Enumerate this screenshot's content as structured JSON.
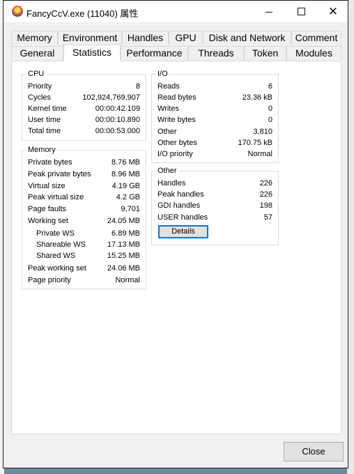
{
  "window": {
    "title": "FancyCcV.exe (11040) 属性"
  },
  "tabs_row1": [
    "Memory",
    "Environment",
    "Handles",
    "GPU",
    "Disk and Network",
    "Comment"
  ],
  "tabs_row2": [
    "General",
    "Statistics",
    "Performance",
    "Threads",
    "Token",
    "Modules"
  ],
  "active_tab": "Statistics",
  "cpu": {
    "title": "CPU",
    "rows": [
      {
        "label": "Priority",
        "value": "8"
      },
      {
        "label": "Cycles",
        "value": "102,924,769,907"
      },
      {
        "label": "Kernel time",
        "value": "00:00:42.109"
      },
      {
        "label": "User time",
        "value": "00:00:10.890"
      },
      {
        "label": "Total time",
        "value": "00:00:53.000"
      }
    ]
  },
  "memory": {
    "title": "Memory",
    "rows": [
      {
        "label": "Private bytes",
        "value": "8.76 MB"
      },
      {
        "label": "Peak private bytes",
        "value": "8.96 MB"
      },
      {
        "label": "Virtual size",
        "value": "4.19 GB"
      },
      {
        "label": "Peak virtual size",
        "value": "4.2 GB"
      },
      {
        "label": "Page faults",
        "value": "9,701"
      },
      {
        "label": "Working set",
        "value": "24.05 MB"
      },
      {
        "label": "Private WS",
        "value": "6.89 MB"
      },
      {
        "label": "Shareable WS",
        "value": "17.13 MB"
      },
      {
        "label": "Shared WS",
        "value": "15.25 MB"
      },
      {
        "label": "Peak working set",
        "value": "24.06 MB"
      },
      {
        "label": "Page priority",
        "value": "Normal"
      }
    ]
  },
  "io": {
    "title": "I/O",
    "rows": [
      {
        "label": "Reads",
        "value": "6"
      },
      {
        "label": "Read bytes",
        "value": "23.36 kB"
      },
      {
        "label": "Writes",
        "value": "0"
      },
      {
        "label": "Write bytes",
        "value": "0"
      },
      {
        "label": "Other",
        "value": "3,810"
      },
      {
        "label": "Other bytes",
        "value": "170.75 kB"
      },
      {
        "label": "I/O priority",
        "value": "Normal"
      }
    ]
  },
  "other": {
    "title": "Other",
    "rows": [
      {
        "label": "Handles",
        "value": "226"
      },
      {
        "label": "Peak handles",
        "value": "226"
      },
      {
        "label": "GDI handles",
        "value": "198"
      },
      {
        "label": "USER handles",
        "value": "57"
      }
    ],
    "details_label": "Details"
  },
  "close_label": "Close",
  "colors": {
    "focus_border": "#0078d7",
    "background_app": "#6f8a9a"
  }
}
